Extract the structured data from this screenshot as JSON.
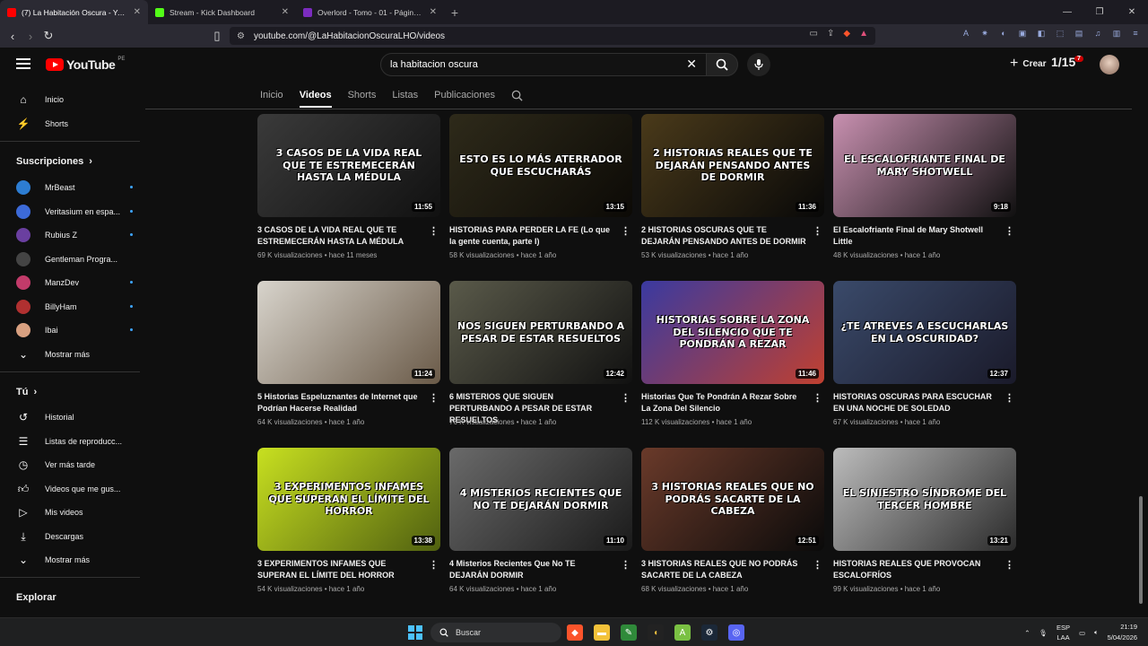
{
  "browser": {
    "tabs": [
      {
        "title": "(7) La Habitación Oscura - YouTube",
        "color": "#ff0000"
      },
      {
        "title": "Stream - Kick Dashboard",
        "color": "#53fc18"
      },
      {
        "title": "Overlord - Tomo - 01 - Página 1",
        "color": "#7b2cbf"
      }
    ],
    "url": "youtube.com/@LaHabitacionOscuraLHO/videos"
  },
  "header": {
    "logo_text": "YouTube",
    "region": "PE",
    "search_value": "la habitacion oscura",
    "create_label": "Crear",
    "notif_text": "1/15",
    "notif_count": "7"
  },
  "sidebar": {
    "main": [
      {
        "label": "Inicio",
        "icon": "home-icon"
      },
      {
        "label": "Shorts",
        "icon": "shorts-icon"
      }
    ],
    "subs_title": "Suscripciones",
    "subs": [
      {
        "label": "MrBeast",
        "color": "#2d7dd2",
        "dot": true
      },
      {
        "label": "Veritasium en espa...",
        "color": "#3c6ad8",
        "dot": true
      },
      {
        "label": "Rubius Z",
        "color": "#6a3fa0",
        "dot": true
      },
      {
        "label": "Gentleman Progra...",
        "color": "#333333",
        "dot": false
      },
      {
        "label": "ManzDev",
        "color": "#c23b6a",
        "dot": true
      },
      {
        "label": "BillyHam",
        "color": "#b03030",
        "dot": true
      },
      {
        "label": "Ibai",
        "color": "#d8a080",
        "dot": true
      }
    ],
    "show_more": "Mostrar más",
    "you_title": "Tú",
    "you": [
      {
        "label": "Historial",
        "icon": "history-icon"
      },
      {
        "label": "Listas de reproducc...",
        "icon": "playlist-icon"
      },
      {
        "label": "Ver más tarde",
        "icon": "clock-icon"
      },
      {
        "label": "Videos que me gus...",
        "icon": "like-icon"
      },
      {
        "label": "Mis videos",
        "icon": "my-videos-icon"
      },
      {
        "label": "Descargas",
        "icon": "download-icon"
      }
    ],
    "show_more_2": "Mostrar más",
    "explore_title": "Explorar"
  },
  "channel_tabs": [
    "Inicio",
    "Videos",
    "Shorts",
    "Listas",
    "Publicaciones"
  ],
  "active_tab": "Videos",
  "videos": [
    {
      "thumb_text": "3 CASOS DE LA VIDA REAL QUE TE ESTREMECERÁN HASTA LA MÉDULA",
      "bg": "#3a3a3a",
      "bg2": "#111111",
      "duration": "11:55",
      "title": "3 CASOS DE LA VIDA REAL QUE TE ESTREMECERÁN HASTA LA MÉDULA",
      "meta": "69 K visualizaciones • hace 11 meses"
    },
    {
      "thumb_text": "ESTO ES LO MÁS ATERRADOR QUE ESCUCHARÁS",
      "bg": "#2e2a1a",
      "bg2": "#0c0a06",
      "duration": "13:15",
      "title": "HISTORIAS PARA PERDER LA FE (Lo que la gente cuenta, parte I)",
      "meta": "58 K visualizaciones • hace 1 año"
    },
    {
      "thumb_text": "2 HISTORIAS REALES QUE TE DEJARÁN PENSANDO ANTES DE DORMIR",
      "bg": "#4a3a1a",
      "bg2": "#080808",
      "duration": "11:36",
      "title": "2 HISTORIAS OSCURAS QUE TE DEJARÁN PENSANDO ANTES DE DORMIR",
      "meta": "53 K visualizaciones • hace 1 año"
    },
    {
      "thumb_text": "EL ESCALOFRIANTE FINAL DE MARY SHOTWELL",
      "bg": "#c890b0",
      "bg2": "#101010",
      "duration": "9:18",
      "title": "El Escalofriante Final de Mary Shotwell Little",
      "meta": "48 K visualizaciones • hace 1 año"
    },
    {
      "thumb_text": "",
      "bg": "#d8d4cc",
      "bg2": "#6a5a48",
      "duration": "11:24",
      "title": "5 Historias Espeluznantes de Internet que Podrían Hacerse Realidad",
      "meta": "64 K visualizaciones • hace 1 año"
    },
    {
      "thumb_text": "NOS SIGUEN PERTURBANDO A PESAR DE ESTAR RESUELTOS",
      "bg": "#5a5a4a",
      "bg2": "#111111",
      "duration": "12:42",
      "title": "6 MISTERIOS QUE SIGUEN PERTURBANDO A PESAR DE ESTAR RESUELTOS",
      "meta": "76 K visualizaciones • hace 1 año"
    },
    {
      "thumb_text": "HISTORIAS SOBRE LA ZONA DEL SILENCIO QUE TE PONDRÁN A REZAR",
      "bg": "#3a3aa0",
      "bg2": "#c04030",
      "duration": "11:46",
      "title": "Historias Que Te Pondrán A Rezar Sobre La Zona Del Silencio",
      "meta": "112 K visualizaciones • hace 1 año"
    },
    {
      "thumb_text": "¿TE ATREVES A ESCUCHARLAS EN LA OSCURIDAD?",
      "bg": "#3a4a6a",
      "bg2": "#1a1a2a",
      "duration": "12:37",
      "title": "HISTORIAS OSCURAS PARA ESCUCHAR EN UNA NOCHE DE SOLEDAD",
      "meta": "67 K visualizaciones • hace 1 año"
    },
    {
      "thumb_text": "3 EXPERIMENTOS INFAMES QUE SUPERAN EL LÍMITE DEL HORROR",
      "bg": "#c8e020",
      "bg2": "#506010",
      "duration": "13:38",
      "title": "3 EXPERIMENTOS INFAMES QUE SUPERAN EL LÍMITE DEL HORROR",
      "meta": "54 K visualizaciones • hace 1 año"
    },
    {
      "thumb_text": "4 MISTERIOS RECIENTES QUE NO TE DEJARÁN DORMIR",
      "bg": "#6a6a6a",
      "bg2": "#1a1a1a",
      "duration": "11:10",
      "title": "4 Misterios Recientes Que No TE DEJARÁN DORMIR",
      "meta": "64 K visualizaciones • hace 1 año"
    },
    {
      "thumb_text": "3 HISTORIAS REALES QUE NO PODRÁS SACARTE DE LA CABEZA",
      "bg": "#6a3a2a",
      "bg2": "#0a0a0a",
      "duration": "12:51",
      "title": "3 HISTORIAS REALES QUE NO PODRÁS SACARTE DE LA CABEZA",
      "meta": "68 K visualizaciones • hace 1 año"
    },
    {
      "thumb_text": "EL SINIESTRO SÍNDROME DEL TERCER HOMBRE",
      "bg": "#bcbcbc",
      "bg2": "#2a2a2a",
      "duration": "13:21",
      "title": "HISTORIAS REALES QUE PROVOCAN ESCALOFRÍOS",
      "meta": "99 K visualizaciones • hace 1 año"
    }
  ],
  "taskbar": {
    "search_placeholder": "Buscar",
    "lang1": "ESP",
    "lang2": "LAA",
    "time": "21:19",
    "date": "5/04/2026"
  }
}
